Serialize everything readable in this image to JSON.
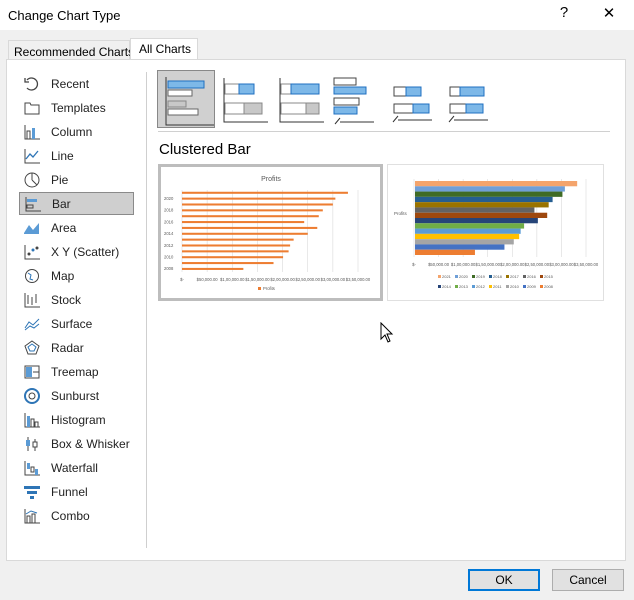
{
  "window": {
    "title": "Change Chart Type",
    "help": "?",
    "close": "✕"
  },
  "tabs": [
    {
      "label": "Recommended Charts"
    },
    {
      "label": "All Charts"
    }
  ],
  "sidebar": {
    "items": [
      {
        "label": "Recent",
        "icon": "recent-icon"
      },
      {
        "label": "Templates",
        "icon": "folder-icon"
      },
      {
        "label": "Column",
        "icon": "column-chart-icon"
      },
      {
        "label": "Line",
        "icon": "line-chart-icon"
      },
      {
        "label": "Pie",
        "icon": "pie-chart-icon"
      },
      {
        "label": "Bar",
        "icon": "bar-chart-icon",
        "selected": true
      },
      {
        "label": "Area",
        "icon": "area-chart-icon"
      },
      {
        "label": "X Y (Scatter)",
        "icon": "scatter-chart-icon"
      },
      {
        "label": "Map",
        "icon": "map-chart-icon"
      },
      {
        "label": "Stock",
        "icon": "stock-chart-icon"
      },
      {
        "label": "Surface",
        "icon": "surface-chart-icon"
      },
      {
        "label": "Radar",
        "icon": "radar-chart-icon"
      },
      {
        "label": "Treemap",
        "icon": "treemap-chart-icon"
      },
      {
        "label": "Sunburst",
        "icon": "sunburst-chart-icon"
      },
      {
        "label": "Histogram",
        "icon": "histogram-chart-icon"
      },
      {
        "label": "Box & Whisker",
        "icon": "box-whisker-chart-icon"
      },
      {
        "label": "Waterfall",
        "icon": "waterfall-chart-icon"
      },
      {
        "label": "Funnel",
        "icon": "funnel-chart-icon"
      },
      {
        "label": "Combo",
        "icon": "combo-chart-icon"
      }
    ]
  },
  "subtypes": [
    "clustered-bar",
    "stacked-bar",
    "100-stacked-bar",
    "3d-clustered-bar",
    "3d-stacked-bar",
    "3d-100-stacked-bar"
  ],
  "selected_subtype_label": "Clustered Bar",
  "chart_data": [
    {
      "type": "bar",
      "title": "Profits",
      "categories": [
        "2021",
        "2020",
        "2019",
        "2018",
        "2017",
        "2016",
        "2015",
        "2014",
        "2013",
        "2012",
        "2011",
        "2010",
        "2009",
        "2008"
      ],
      "y_tick_labels": [
        "2020",
        "2018",
        "2016",
        "2014",
        "2012",
        "2010",
        "2008"
      ],
      "values": [
        330000,
        305000,
        300000,
        280000,
        272000,
        243000,
        269000,
        250000,
        222000,
        215000,
        212000,
        201000,
        182000,
        122000
      ],
      "x_ticks": [
        "$-",
        "$50,000.00",
        "$1,00,000.00",
        "$1,50,000.00",
        "$2,00,000.00",
        "$2,50,000.00",
        "$3,00,000.00",
        "$3,50,000.00"
      ],
      "xlim": [
        0,
        350000
      ],
      "legend": "Profits",
      "legend_position": "bottom",
      "color": "#ed7d31"
    },
    {
      "type": "bar",
      "category": "Profits",
      "series": [
        {
          "name": "2021",
          "value": 330000,
          "color": "#f4a46c"
        },
        {
          "name": "2020",
          "value": 305000,
          "color": "#6f9fd8"
        },
        {
          "name": "2019",
          "value": 300000,
          "color": "#3f6b25"
        },
        {
          "name": "2018",
          "value": 280000,
          "color": "#255e91"
        },
        {
          "name": "2017",
          "value": 272000,
          "color": "#997300"
        },
        {
          "name": "2016",
          "value": 243000,
          "color": "#636363"
        },
        {
          "name": "2015",
          "value": 269000,
          "color": "#9e480e"
        },
        {
          "name": "2014",
          "value": 250000,
          "color": "#264478"
        },
        {
          "name": "2013",
          "value": 222000,
          "color": "#70ad47"
        },
        {
          "name": "2012",
          "value": 215000,
          "color": "#5b9bd5"
        },
        {
          "name": "2011",
          "value": 212000,
          "color": "#ffc000"
        },
        {
          "name": "2010",
          "value": 201000,
          "color": "#a5a5a5"
        },
        {
          "name": "2009",
          "value": 182000,
          "color": "#4472c4"
        },
        {
          "name": "2008",
          "value": 122000,
          "color": "#ed7d31"
        }
      ],
      "x_ticks": [
        "$-",
        "$50,000.00",
        "$1,00,000.00",
        "$1,50,000.00",
        "$2,00,000.00",
        "$2,50,000.00",
        "$3,00,000.00",
        "$3,50,000.00"
      ],
      "xlim": [
        0,
        350000
      ],
      "legend_position": "bottom"
    }
  ],
  "buttons": {
    "ok": "OK",
    "cancel": "Cancel"
  }
}
